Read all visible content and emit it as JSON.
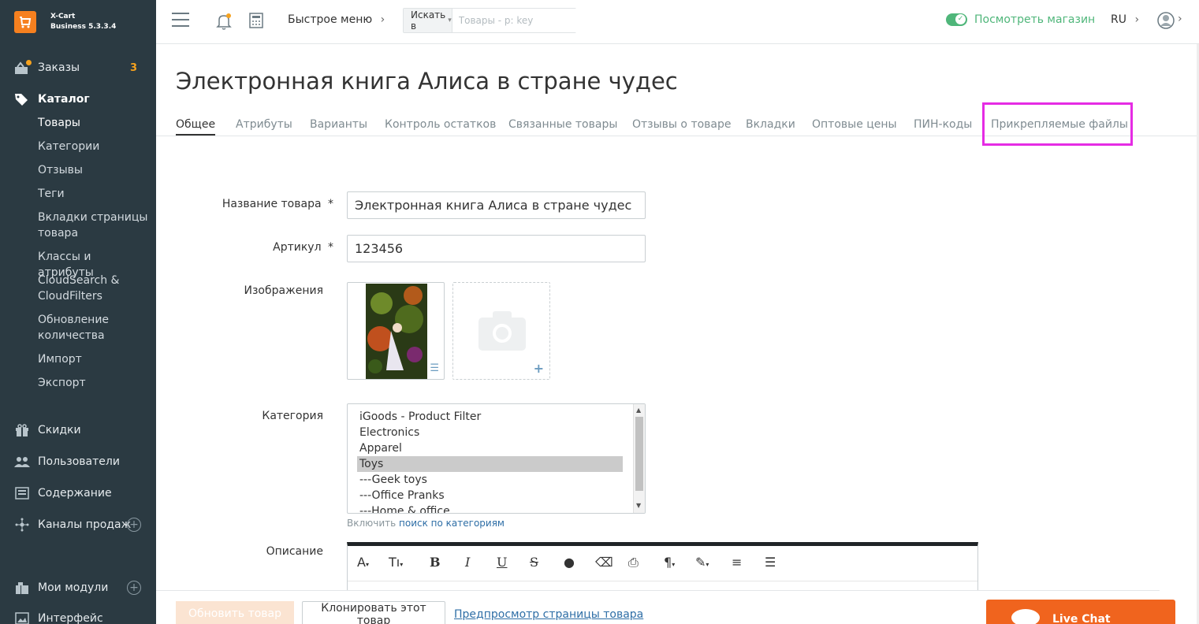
{
  "app": {
    "logo_line1": "X-Cart",
    "logo_line2": "Business 5.3.3.4"
  },
  "sidebar": {
    "orders": {
      "label": "Заказы",
      "count": "3"
    },
    "catalog": {
      "label": "Каталог"
    },
    "catalog_items": [
      "Товары",
      "Категории",
      "Отзывы",
      "Теги",
      "Вкладки страницы товара",
      "Классы и атрибуты",
      "CloudSearch & CloudFilters",
      "Обновление количества",
      "Импорт",
      "Экспорт"
    ],
    "discounts": "Скидки",
    "users": "Пользователи",
    "content": "Содержание",
    "sales_channels": "Каналы продаж",
    "my_modules": "Мои модули",
    "interface": "Интерфейс"
  },
  "header": {
    "quick_menu": "Быстрое меню",
    "search_scope": "Искать в",
    "search_placeholder": "Товары - p: key",
    "view_store": "Посмотреть магазин",
    "lang": "RU"
  },
  "page": {
    "title": "Электронная книга Алиса в стране чудес",
    "tabs": [
      "Общее",
      "Атрибуты",
      "Варианты",
      "Контроль остатков",
      "Связанные товары",
      "Отзывы о товаре",
      "Вкладки",
      "Оптовые цены",
      "ПИН-коды",
      "Прикрепляемые файлы"
    ]
  },
  "form": {
    "name_label": "Название товара",
    "name_value": "Электронная книга Алиса в стране чудес",
    "sku_label": "Артикул",
    "sku_value": "123456",
    "required_mark": "*",
    "images_label": "Изображения",
    "category_label": "Категория",
    "categories": [
      "iGoods - Product Filter",
      "Electronics",
      "Apparel",
      "Toys",
      "---Geek toys",
      "---Office Pranks",
      "---Home & office"
    ],
    "selected_category": "Toys",
    "category_hint_prefix": "Включить",
    "category_hint_link": "поиск по категориям",
    "description_label": "Описание"
  },
  "bottom": {
    "update_button": "Обновить товар",
    "clone_button": "Клонировать этот товар",
    "preview_link": "Предпросмотр страницы товара",
    "live_chat": "Live Chat"
  },
  "colors": {
    "sidebar_bg": "#2b3a42",
    "brand_orange": "#f6801f",
    "green": "#4fb67a",
    "highlight": "#e52ce4",
    "livechat": "#f0641e"
  }
}
